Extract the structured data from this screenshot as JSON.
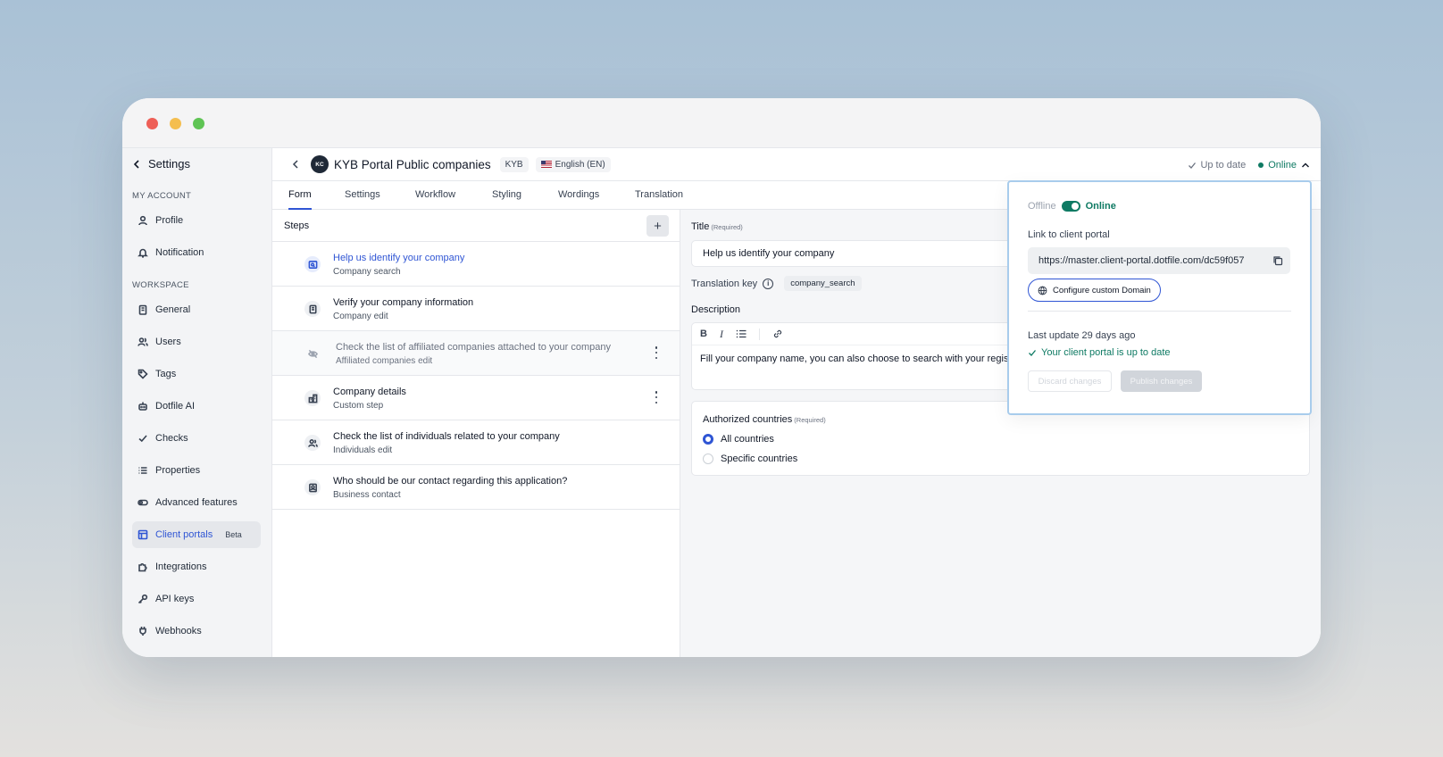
{
  "window": {
    "controls": {
      "close": "close",
      "minimize": "minimize",
      "maximize": "maximize"
    }
  },
  "sidebar": {
    "back_label": "Settings",
    "sections": {
      "my_account": "MY ACCOUNT",
      "workspace": "WORKSPACE"
    },
    "items": [
      {
        "label": "Profile",
        "icon": "user-icon"
      },
      {
        "label": "Notification",
        "icon": "bell-icon"
      },
      {
        "label": "General",
        "icon": "building-icon"
      },
      {
        "label": "Users",
        "icon": "users-icon"
      },
      {
        "label": "Tags",
        "icon": "tag-icon"
      },
      {
        "label": "Dotfile AI",
        "icon": "robot-icon"
      },
      {
        "label": "Checks",
        "icon": "check-icon"
      },
      {
        "label": "Properties",
        "icon": "list-icon"
      },
      {
        "label": "Advanced features",
        "icon": "toggle-icon"
      },
      {
        "label": "Client portals",
        "icon": "layout-icon",
        "badge": "Beta",
        "active": true
      },
      {
        "label": "Integrations",
        "icon": "puzzle-icon"
      },
      {
        "label": "API keys",
        "icon": "key-icon"
      },
      {
        "label": "Webhooks",
        "icon": "plug-icon"
      }
    ]
  },
  "header": {
    "avatar_initials": "KC",
    "title": "KYB Portal Public companies",
    "type_badge": "KYB",
    "language": "English (EN)",
    "sync_status": "Up to date",
    "online_status": "Online"
  },
  "tabs": [
    {
      "label": "Form",
      "active": true
    },
    {
      "label": "Settings"
    },
    {
      "label": "Workflow"
    },
    {
      "label": "Styling"
    },
    {
      "label": "Wordings"
    },
    {
      "label": "Translation"
    }
  ],
  "steps": {
    "heading": "Steps",
    "add_label": "+",
    "items": [
      {
        "title": "Help us identify your company",
        "subtitle": "Company search",
        "icon": "company-search-icon",
        "selected": true
      },
      {
        "title": "Verify your company information",
        "subtitle": "Company edit",
        "icon": "building-icon"
      },
      {
        "title": "Check the list of affiliated companies attached to your company",
        "subtitle": "Affiliated companies edit",
        "icon": "eye-off-icon",
        "disabled": true,
        "menu": true
      },
      {
        "title": "Company details",
        "subtitle": "Custom step",
        "icon": "custom-step-icon",
        "menu": true
      },
      {
        "title": "Check the list of individuals related to your company",
        "subtitle": "Individuals edit",
        "icon": "users-icon"
      },
      {
        "title": "Who should be our contact regarding this application?",
        "subtitle": "Business contact",
        "icon": "contact-icon"
      }
    ]
  },
  "editor": {
    "title_label": "Title",
    "required_label": "(Required)",
    "title_value": "Help us identify your company",
    "translation_key_label": "Translation key",
    "translation_key_value": "company_search",
    "description_label": "Description",
    "toolbar": {
      "bold": "B",
      "italic": "I"
    },
    "description_value": "Fill your company name, you can also choose to search with your registration number",
    "countries_label": "Authorized countries",
    "countries_required": "(Required)",
    "country_options": [
      {
        "label": "All countries",
        "selected": true
      },
      {
        "label": "Specific countries",
        "selected": false
      }
    ]
  },
  "popover": {
    "offline_label": "Offline",
    "online_label": "Online",
    "link_label": "Link to client portal",
    "url": "https://master.client-portal.dotfile.com/dc59f057",
    "configure_domain": "Configure custom Domain",
    "last_update": "Last update 29 days ago",
    "up_to_date": "Your client portal is up to date",
    "discard": "Discard changes",
    "publish": "Publish changes"
  },
  "colors": {
    "accent": "#2f55d4",
    "online": "#0e7a63",
    "popover_border": "#a8ccec"
  }
}
